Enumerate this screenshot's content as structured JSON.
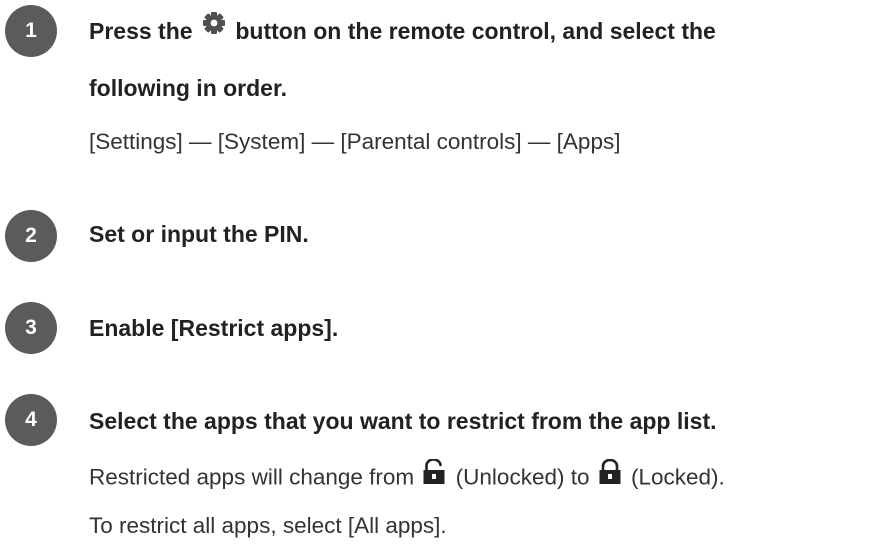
{
  "steps": [
    {
      "number": "1",
      "heading_part1": "Press the",
      "heading_icon": "gear-icon",
      "heading_part2": "button on the remote control, and select the",
      "heading_line2": "following in order.",
      "body": "[Settings] — [System] — [Parental controls] — [Apps]"
    },
    {
      "number": "2",
      "heading": "Set or input the PIN."
    },
    {
      "number": "3",
      "heading": "Enable [Restrict apps]."
    },
    {
      "number": "4",
      "heading": "Select the apps that you want to restrict from the app list.",
      "body_part1": "Restricted apps will change from",
      "unlocked_icon": "unlocked-padlock-icon",
      "body_part2": "(Unlocked) to",
      "locked_icon": "locked-padlock-icon",
      "body_part3": "(Locked).",
      "body_line2": "To restrict all apps, select [All apps]."
    }
  ],
  "colors": {
    "badge": "#5b5b5b",
    "text": "#222222"
  }
}
